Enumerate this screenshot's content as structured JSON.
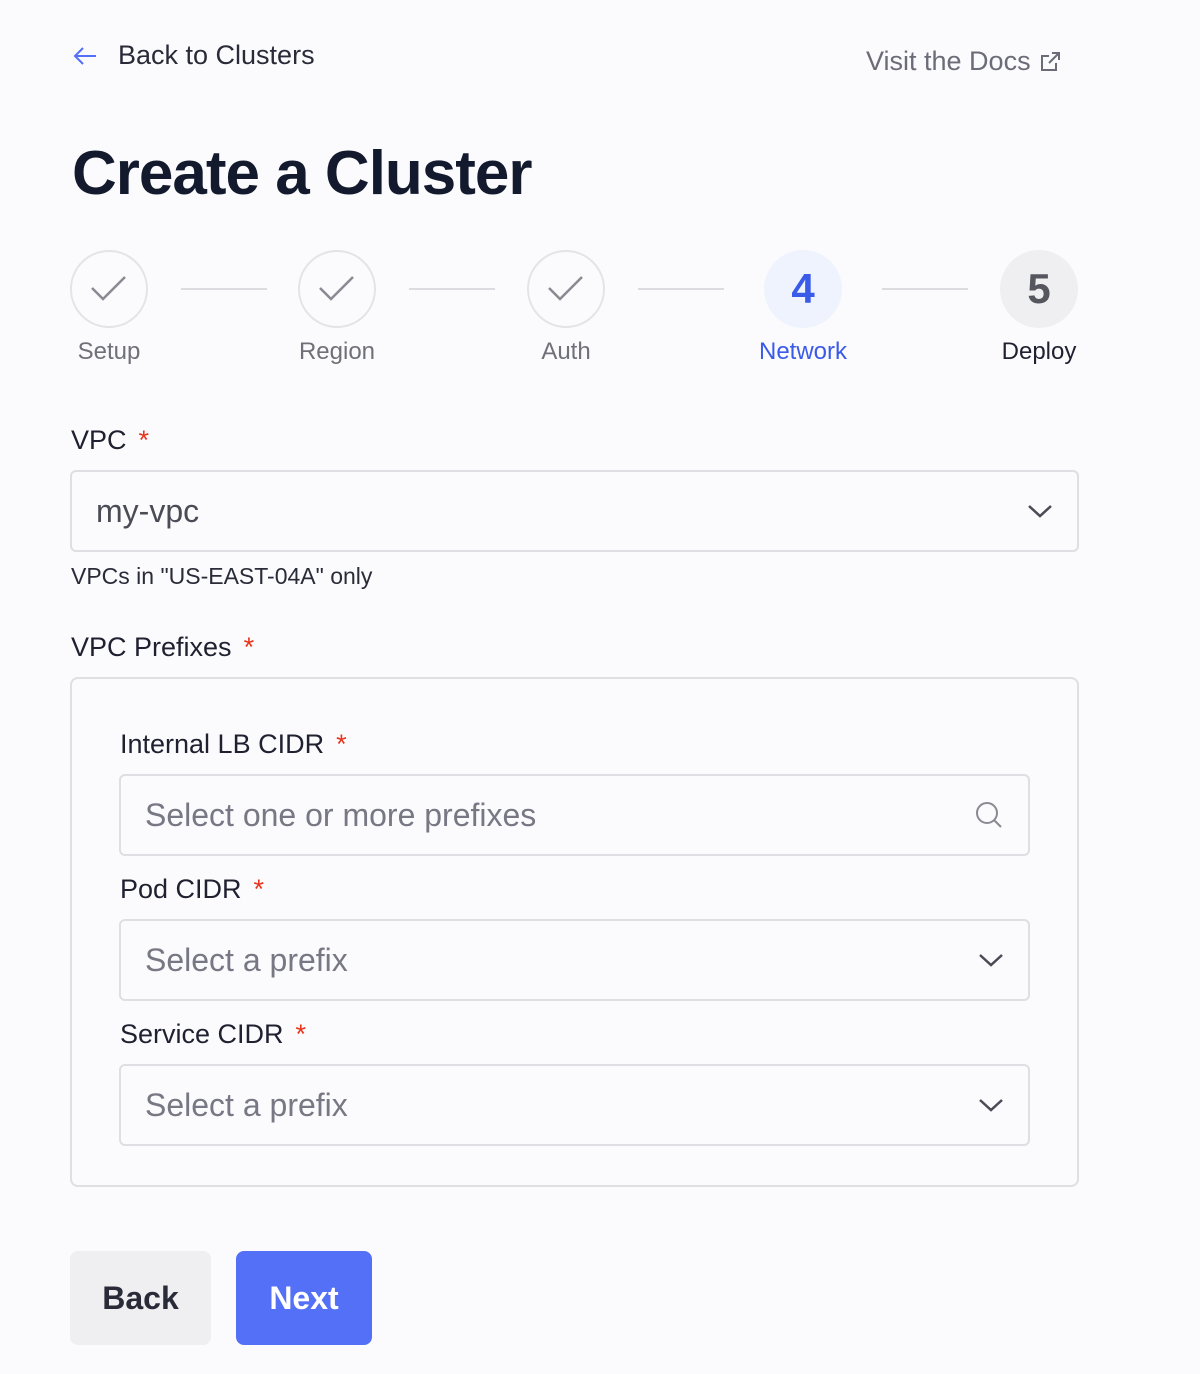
{
  "nav": {
    "back_label": "Back to Clusters",
    "docs_label": "Visit the Docs"
  },
  "page_title": "Create a Cluster",
  "steps": [
    {
      "label": "Setup",
      "status": "complete"
    },
    {
      "label": "Region",
      "status": "complete"
    },
    {
      "label": "Auth",
      "status": "complete"
    },
    {
      "label": "Network",
      "number": "4",
      "status": "current"
    },
    {
      "label": "Deploy",
      "number": "5",
      "status": "upcoming"
    }
  ],
  "form": {
    "vpc": {
      "label": "VPC",
      "required": "*",
      "value": "my-vpc",
      "help": "VPCs in \"US-EAST-04A\" only"
    },
    "prefixes": {
      "label": "VPC Prefixes",
      "required": "*",
      "internal_lb": {
        "label": "Internal LB CIDR",
        "required": "*",
        "placeholder": "Select one or more prefixes"
      },
      "pod": {
        "label": "Pod CIDR",
        "required": "*",
        "placeholder": "Select a prefix"
      },
      "service": {
        "label": "Service CIDR",
        "required": "*",
        "placeholder": "Select a prefix"
      }
    }
  },
  "actions": {
    "back": "Back",
    "next": "Next"
  },
  "colors": {
    "accent": "#5470f7",
    "current_step": "#3a5ae8",
    "required": "#e8341c"
  }
}
